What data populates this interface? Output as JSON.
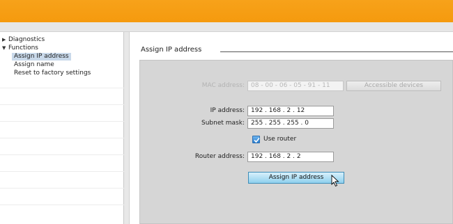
{
  "tree": {
    "diagnostics": "Diagnostics",
    "functions": "Functions",
    "items": [
      {
        "label": "Assign IP address"
      },
      {
        "label": "Assign name"
      },
      {
        "label": "Reset to factory settings"
      }
    ]
  },
  "main": {
    "section_title": "Assign IP address",
    "mac_label": "MAC address:",
    "mac_value": "08 - 00 - 06 - 05 - 91 - 11",
    "accessible_devices": "Accessible devices",
    "ip_label": "IP address:",
    "ip_value": "192 . 168 . 2     . 12",
    "subnet_label": "Subnet mask:",
    "subnet_value": "255 . 255 . 255 . 0",
    "use_router_label": "Use router",
    "use_router_checked": true,
    "router_label": "Router address:",
    "router_value": "192 . 168 . 2     . 2",
    "assign_button": "Assign IP address"
  },
  "colors": {
    "title_bar": "#f59a0e",
    "panel": "#d6d6d6",
    "selection": "#c9d9ea",
    "button": "#8fd0ee"
  }
}
